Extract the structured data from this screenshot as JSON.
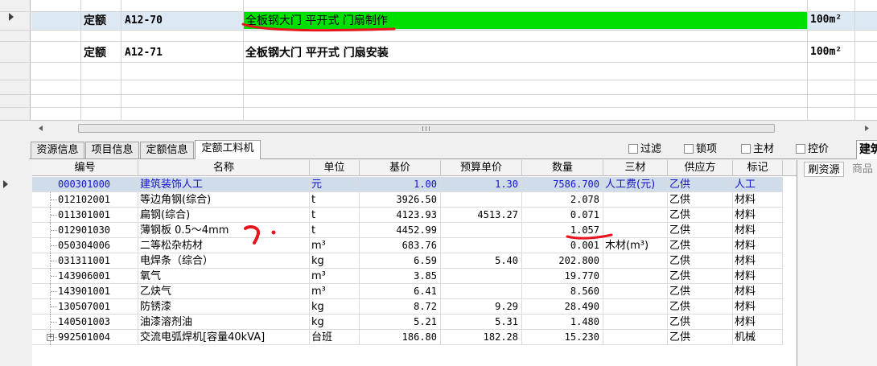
{
  "quota_rows": [
    {
      "type": "定额",
      "code": "A12-70",
      "name": "全板钢大门 平开式 门扇制作",
      "unit": "100m²",
      "highlight": "#00e000"
    },
    {
      "type": "定额",
      "code": "A12-71",
      "name": "全板钢大门 平开式 门扇安装",
      "unit": "100m²"
    }
  ],
  "tabs": [
    "资源信息",
    "项目信息",
    "定额信息",
    "定额工料机"
  ],
  "active_tab": "定额工料机",
  "filters": [
    "过滤",
    "锁项",
    "主材",
    "控价"
  ],
  "build_tab": "建筑",
  "right_panel_tabs": [
    "刷资源",
    "商品"
  ],
  "columns": [
    "编号",
    "名称",
    "单位",
    "基价",
    "预算单价",
    "数量",
    "三材",
    "供应方",
    "标记"
  ],
  "rows": [
    {
      "code": "000301000",
      "name": "建筑装饰人工",
      "unit": "元",
      "base": "1.00",
      "budget": "1.30",
      "qty": "7586.700",
      "sancai": "人工费(元)",
      "supplier": "乙供",
      "mark": "人工"
    },
    {
      "code": "012102001",
      "name": "等边角钢(综合)",
      "unit": "t",
      "base": "3926.50",
      "budget": "",
      "qty": "2.078",
      "sancai": "",
      "supplier": "乙供",
      "mark": "材料"
    },
    {
      "code": "011301001",
      "name": "扁钢(综合)",
      "unit": "t",
      "base": "4123.93",
      "budget": "4513.27",
      "qty": "0.071",
      "sancai": "",
      "supplier": "乙供",
      "mark": "材料"
    },
    {
      "code": "012901030",
      "name": "薄钢板 0.5～4mm",
      "unit": "t",
      "base": "4452.99",
      "budget": "",
      "qty": "1.057",
      "sancai": "",
      "supplier": "乙供",
      "mark": "材料"
    },
    {
      "code": "050304006",
      "name": "二等松杂枋材",
      "unit": "m³",
      "base": "683.76",
      "budget": "",
      "qty": "0.001",
      "sancai": "木材(m³)",
      "supplier": "乙供",
      "mark": "材料"
    },
    {
      "code": "031311001",
      "name": "电焊条（综合）",
      "unit": "kg",
      "base": "6.59",
      "budget": "5.40",
      "qty": "202.800",
      "sancai": "",
      "supplier": "乙供",
      "mark": "材料"
    },
    {
      "code": "143906001",
      "name": "氧气",
      "unit": "m³",
      "base": "3.85",
      "budget": "",
      "qty": "19.770",
      "sancai": "",
      "supplier": "乙供",
      "mark": "材料"
    },
    {
      "code": "143901001",
      "name": "乙炔气",
      "unit": "m³",
      "base": "6.41",
      "budget": "",
      "qty": "8.560",
      "sancai": "",
      "supplier": "乙供",
      "mark": "材料"
    },
    {
      "code": "130507001",
      "name": "防锈漆",
      "unit": "kg",
      "base": "8.72",
      "budget": "9.29",
      "qty": "28.490",
      "sancai": "",
      "supplier": "乙供",
      "mark": "材料"
    },
    {
      "code": "140501003",
      "name": "油漆溶剂油",
      "unit": "kg",
      "base": "5.21",
      "budget": "5.31",
      "qty": "1.480",
      "sancai": "",
      "supplier": "乙供",
      "mark": "材料"
    },
    {
      "code": "992501004",
      "name": "交流电弧焊机[容量40kVA]",
      "unit": "台班",
      "base": "186.80",
      "budget": "182.28",
      "qty": "15.230",
      "sancai": "",
      "supplier": "乙供",
      "mark": "机械"
    }
  ],
  "colors": {
    "highlight_green": "#00e000",
    "selected_text": "#1414c8",
    "annotation_red": "#e8141e"
  }
}
